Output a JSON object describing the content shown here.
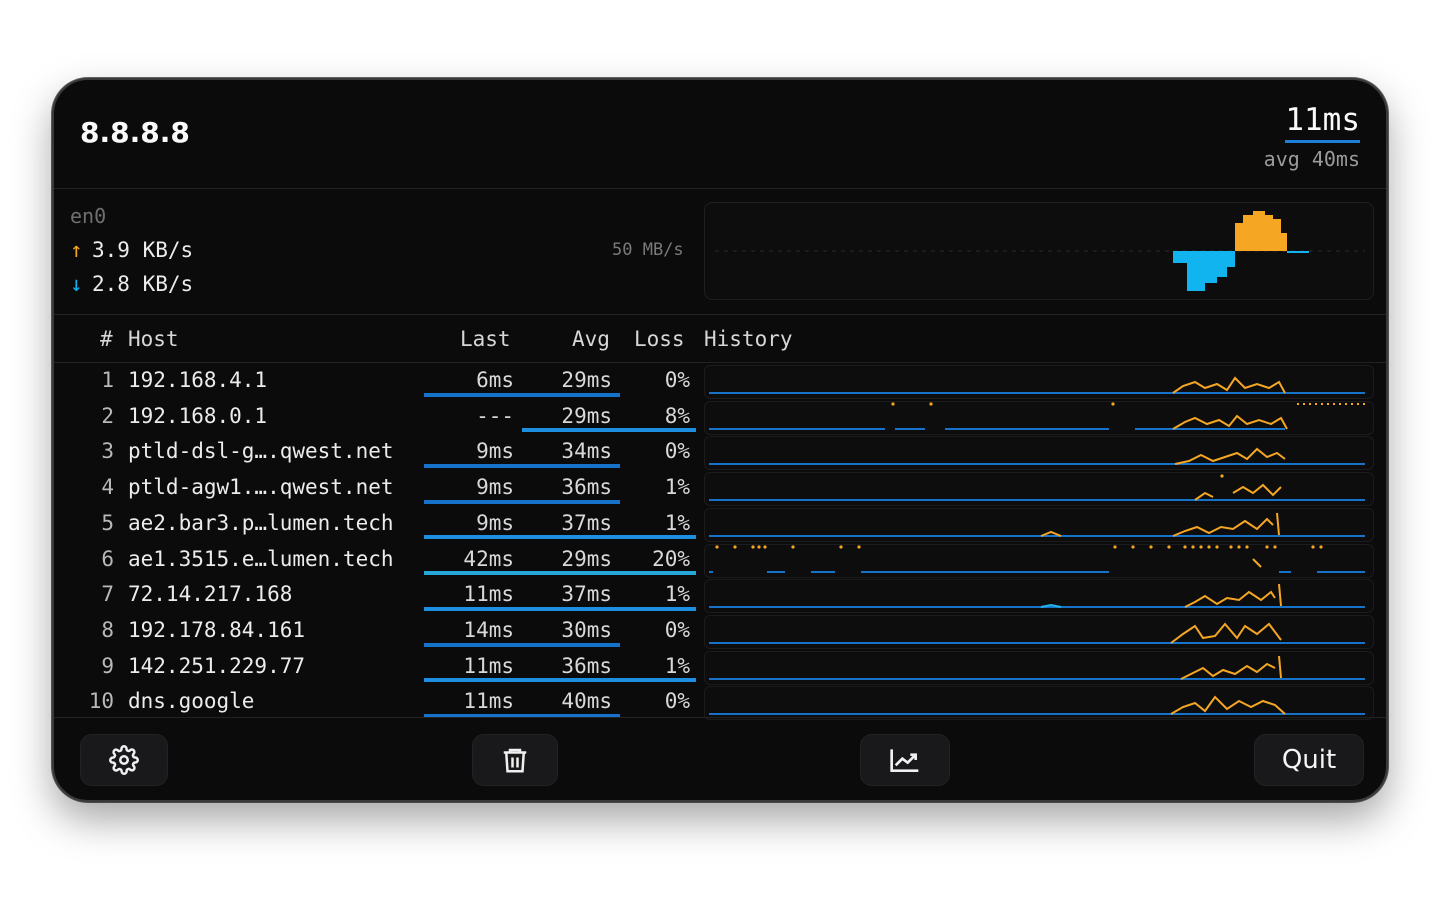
{
  "header": {
    "host": "8.8.8.8",
    "latency": "11ms",
    "avg": "avg 40ms"
  },
  "network": {
    "interface": "en0",
    "upload": "3.9 KB/s",
    "download": "2.8 KB/s",
    "scale": "50 MB/s",
    "up_arrow": "↑",
    "down_arrow": "↓"
  },
  "table": {
    "headers": {
      "num": "#",
      "host": "Host",
      "last": "Last",
      "avg": "Avg",
      "loss": "Loss",
      "history": "History"
    },
    "rows": [
      {
        "n": "1",
        "host": "192.168.4.1",
        "last": "6ms",
        "avg": "29ms",
        "loss": "0%"
      },
      {
        "n": "2",
        "host": "192.168.0.1",
        "last": "---",
        "avg": "29ms",
        "loss": "8%"
      },
      {
        "n": "3",
        "host": "ptld-dsl-g….qwest.net",
        "last": "9ms",
        "avg": "34ms",
        "loss": "0%"
      },
      {
        "n": "4",
        "host": "ptld-agw1.….qwest.net",
        "last": "9ms",
        "avg": "36ms",
        "loss": "1%"
      },
      {
        "n": "5",
        "host": "ae2.bar3.p…lumen.tech",
        "last": "9ms",
        "avg": "37ms",
        "loss": "1%"
      },
      {
        "n": "6",
        "host": "ae1.3515.e…lumen.tech",
        "last": "42ms",
        "avg": "29ms",
        "loss": "20%"
      },
      {
        "n": "7",
        "host": "72.14.217.168",
        "last": "11ms",
        "avg": "37ms",
        "loss": "1%"
      },
      {
        "n": "8",
        "host": "192.178.84.161",
        "last": "14ms",
        "avg": "30ms",
        "loss": "0%"
      },
      {
        "n": "9",
        "host": "142.251.229.77",
        "last": "11ms",
        "avg": "36ms",
        "loss": "1%"
      },
      {
        "n": "10",
        "host": "dns.google",
        "last": "11ms",
        "avg": "40ms",
        "loss": "0%"
      }
    ]
  },
  "footer": {
    "settings_icon": "gear-icon",
    "clear_icon": "trash-icon",
    "graph_icon": "chart-icon",
    "quit": "Quit"
  },
  "colors": {
    "accent": "#1e7fd8",
    "upload": "#f5a623",
    "download": "#12b4f0",
    "background": "#0b0b0c"
  }
}
